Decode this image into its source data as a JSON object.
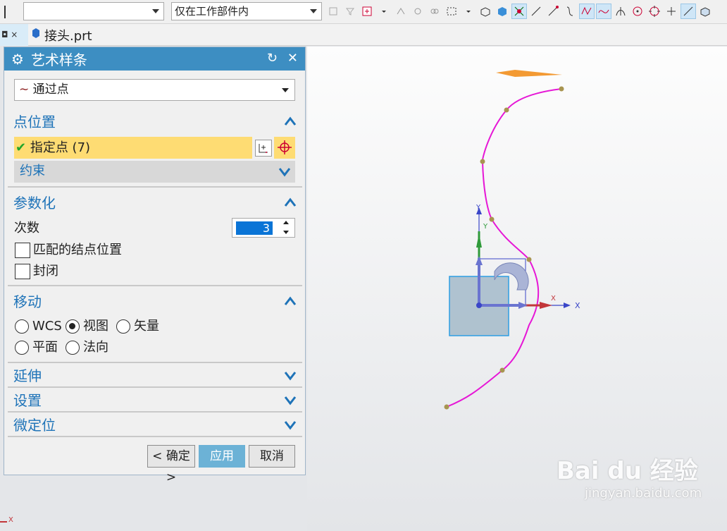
{
  "toolbar": {
    "filter1_value": "",
    "filter2_value": "仅在工作部件内"
  },
  "tab": {
    "left_label": "◘ ×",
    "file_name": "接头.prt"
  },
  "dialog": {
    "title": "艺术样条",
    "type_value": "通过点",
    "point_section": {
      "title": "点位置",
      "specify_label": "指定点 (7)",
      "constraint_label": "约束"
    },
    "param_section": {
      "title": "参数化",
      "degree_label": "次数",
      "degree_value": "3",
      "match_knots_label": "匹配的结点位置",
      "closed_label": "封闭"
    },
    "move_section": {
      "title": "移动",
      "options": [
        "WCS",
        "视图",
        "矢量",
        "平面",
        "法向"
      ],
      "selected": "视图"
    },
    "extend_title": "延伸",
    "settings_title": "设置",
    "fine_title": "微定位",
    "ok_label": "< 确定 >",
    "apply_label": "应用",
    "cancel_label": "取消"
  },
  "viewport": {
    "axis_labels": {
      "x": "X",
      "y": "Y",
      "x2": "X",
      "y2": "Y",
      "corner_x": "X"
    },
    "spline_color": "#e617d6",
    "point_color": "#a89450"
  },
  "watermark": {
    "brand": "Bai du 经验",
    "url": "jingyan.baidu.com"
  }
}
